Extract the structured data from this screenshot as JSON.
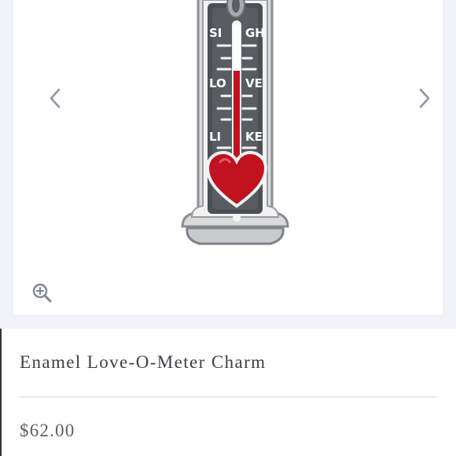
{
  "gallery": {
    "prev_icon": "chevron-left-icon",
    "next_icon": "chevron-right-icon",
    "zoom_icon": "zoom-in-icon",
    "background_color": "#f1f3f8",
    "arrow_color": "#8f95a6",
    "zoom_color": "#7e8595"
  },
  "charm": {
    "left_words": [
      "SI",
      "LO",
      "LI"
    ],
    "right_words": [
      "GH",
      "VE",
      "KE"
    ],
    "enamel_color": "#c1121f"
  },
  "product": {
    "title": "Enamel Love-O-Meter Charm",
    "price": "$62.00"
  }
}
